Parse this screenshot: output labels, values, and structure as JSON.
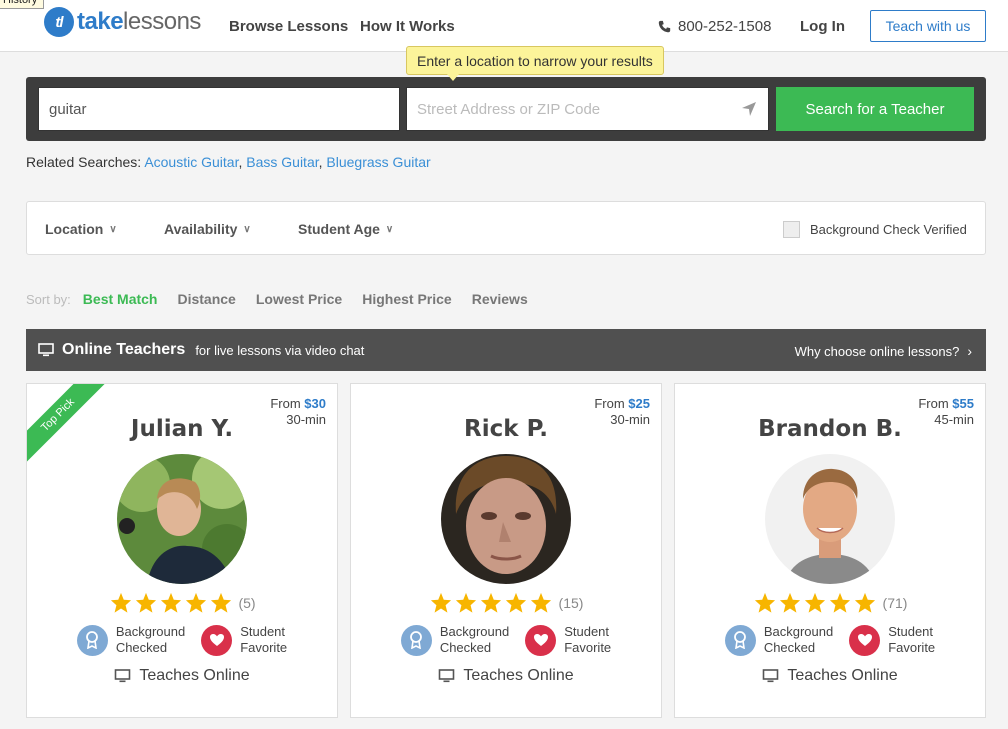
{
  "browser": {
    "history_tooltip": "History"
  },
  "header": {
    "logo_text_bold": "take",
    "logo_text_rest": "lessons",
    "logo_mark": "tl",
    "nav": [
      "Browse Lessons",
      "How It Works"
    ],
    "phone": "800-252-1508",
    "login": "Log In",
    "teach": "Teach with us"
  },
  "tooltip": "Enter a location to narrow your results",
  "search": {
    "query_value": "guitar",
    "location_placeholder": "Street Address or ZIP Code",
    "button": "Search for a Teacher"
  },
  "related": {
    "label": "Related Searches:",
    "links": [
      "Acoustic Guitar",
      "Bass Guitar",
      "Bluegrass Guitar"
    ]
  },
  "filters": {
    "items": [
      "Location",
      "Availability",
      "Student Age"
    ],
    "bg_check": "Background Check Verified"
  },
  "sort": {
    "label": "Sort by:",
    "options": [
      "Best Match",
      "Distance",
      "Lowest Price",
      "Highest Price",
      "Reviews"
    ],
    "active": "Best Match"
  },
  "online": {
    "title": "Online Teachers",
    "subtitle": "for live lessons via video chat",
    "why": "Why choose online lessons?"
  },
  "colors": {
    "accent_green": "#3cba54",
    "brand_blue": "#2e7cc9",
    "star_gold": "#f7b500",
    "heart_red": "#d9304a",
    "badge_blue": "#7fa9d4"
  },
  "teachers": [
    {
      "name": "Julian Y.",
      "from": "From",
      "price": "$30",
      "duration": "30-min",
      "rating_count": "(5)",
      "ribbon": "Top Pick",
      "stars": 5,
      "badge1": [
        "Background",
        "Checked"
      ],
      "badge2": [
        "Student",
        "Favorite"
      ],
      "teaches": "Teaches Online"
    },
    {
      "name": "Rick P.",
      "from": "From",
      "price": "$25",
      "duration": "30-min",
      "rating_count": "(15)",
      "stars": 5,
      "badge1": [
        "Background",
        "Checked"
      ],
      "badge2": [
        "Student",
        "Favorite"
      ],
      "teaches": "Teaches Online"
    },
    {
      "name": "Brandon B.",
      "from": "From",
      "price": "$55",
      "duration": "45-min",
      "rating_count": "(71)",
      "stars": 5,
      "badge1": [
        "Background",
        "Checked"
      ],
      "badge2": [
        "Student",
        "Favorite"
      ],
      "teaches": "Teaches Online"
    }
  ]
}
